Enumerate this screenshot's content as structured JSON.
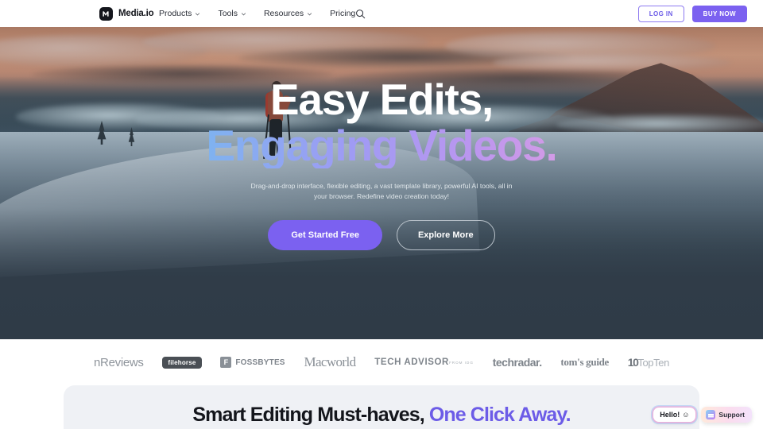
{
  "nav": {
    "logo_text": "Media.io",
    "logo_icon": "media-io-logo-mark",
    "links": [
      {
        "label": "Products",
        "has_dropdown": true
      },
      {
        "label": "Tools",
        "has_dropdown": true
      },
      {
        "label": "Resources",
        "has_dropdown": true
      },
      {
        "label": "Pricing",
        "has_dropdown": false
      }
    ],
    "search_icon": "search-icon",
    "login_label": "LOG IN",
    "buy_label": "BUY NOW"
  },
  "hero": {
    "headline_line1": "Easy Edits,",
    "headline_line2": "Engaging Videos.",
    "subtitle": "Drag-and-drop interface, flexible editing, a vast template library, powerful AI tools, all in your browser. Redefine video creation today!",
    "primary_cta": "Get Started Free",
    "secondary_cta": "Explore More",
    "gradient_start": "#3ae4f0",
    "gradient_end": "#f2a8d8"
  },
  "press_logos": [
    {
      "name": "tenreviews",
      "text": "nReviews"
    },
    {
      "name": "filehorse",
      "text": "filehorse"
    },
    {
      "name": "fossbytes",
      "text": "FOSSBYTES",
      "mark": "F"
    },
    {
      "name": "macworld",
      "text": "Macworld"
    },
    {
      "name": "techadvisor",
      "text": "TECH ADVISOR",
      "sub": "FROM IDG"
    },
    {
      "name": "techradar",
      "text": "techradar."
    },
    {
      "name": "tomsguide",
      "text": "tom's guide"
    },
    {
      "name": "topten",
      "num": "10",
      "text": "TopTen"
    }
  ],
  "section": {
    "title_dark": "Smart Editing Must-haves,",
    "title_accent": " One Click Away."
  },
  "widgets": {
    "hello_label": "Hello!",
    "hello_emoji": "☺",
    "support_label": "Support",
    "support_icon": "chat-bubble-icon"
  },
  "colors": {
    "brand_purple": "#7b61f0",
    "accent_purple": "#6c5ce7",
    "hero_dark": "#2f3b47",
    "card_bg": "#eff1f5"
  }
}
